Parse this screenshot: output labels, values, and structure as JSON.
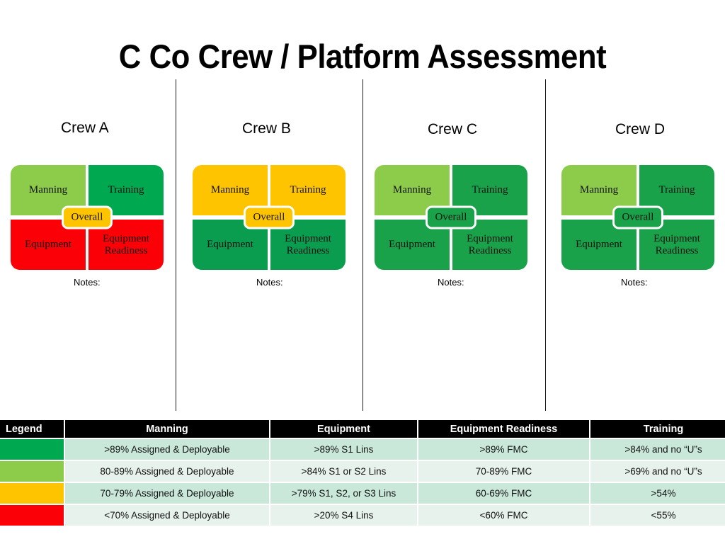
{
  "title": "C Co Crew / Platform Assessment",
  "palette": {
    "green": "#00a84f",
    "light_green": "#8dcc4b",
    "yellow": "#ffc400",
    "red": "#fb0007",
    "header_bg": "#000000",
    "row_shade": "#c9e8da",
    "row_plain": "#e7f2ec"
  },
  "quadrant_labels": {
    "manning": "Manning",
    "training": "Training",
    "equipment": "Equipment",
    "equipment_readiness": "Equipment Readiness",
    "overall": "Overall",
    "notes": "Notes:"
  },
  "crews": [
    {
      "name": "Crew A",
      "manning": "Manning",
      "training": "Training",
      "equipment": "Equipment",
      "equipment_readiness": "Equipment Readiness",
      "overall": "Overall",
      "notes": "Notes:",
      "manning_color": "#8dcc4b",
      "training_color": "#00a84f",
      "equipment_color": "#fb0007",
      "equipment_readiness_color": "#fb0007",
      "overall_color": "#ffc400"
    },
    {
      "name": "Crew B",
      "manning": "Manning",
      "training": "Training",
      "equipment": "Equipment",
      "equipment_readiness": "Equipment Readiness",
      "overall": "Overall",
      "notes": "Notes:",
      "manning_color": "#ffc400",
      "training_color": "#ffc400",
      "equipment_color": "#0a9d4f",
      "equipment_readiness_color": "#0a9d4f",
      "overall_color": "#ffc400"
    },
    {
      "name": "Crew C",
      "manning": "Manning",
      "training": "Training",
      "equipment": "Equipment",
      "equipment_readiness": "Equipment Readiness",
      "overall": "Overall",
      "notes": "Notes:",
      "manning_color": "#8dcc4b",
      "training_color": "#1aa24a",
      "equipment_color": "#1aa24a",
      "equipment_readiness_color": "#1aa24a",
      "overall_color": "#1aa24a"
    },
    {
      "name": "Crew D",
      "manning": "Manning",
      "training": "Training",
      "equipment": "Equipment",
      "equipment_readiness": "Equipment Readiness",
      "overall": "Overall",
      "notes": "Notes:",
      "manning_color": "#8dcc4b",
      "training_color": "#1aa24a",
      "equipment_color": "#1aa24a",
      "equipment_readiness_color": "#1aa24a",
      "overall_color": "#1aa24a"
    }
  ],
  "legend": {
    "headers": [
      "Legend",
      "Manning",
      "Equipment",
      "Equipment Readiness",
      "Training"
    ],
    "rows": [
      {
        "color": "#00a84f",
        "manning": ">89% Assigned & Deployable",
        "equipment": ">89% S1 Lins",
        "equipment_readiness": ">89% FMC",
        "training": ">84% and no “U”s"
      },
      {
        "color": "#8dcc4b",
        "manning": "80-89% Assigned & Deployable",
        "equipment": ">84% S1 or S2 Lins",
        "equipment_readiness": "70-89% FMC",
        "training": ">69% and no “U”s"
      },
      {
        "color": "#ffc400",
        "manning": "70-79% Assigned & Deployable",
        "equipment": ">79% S1, S2, or S3 Lins",
        "equipment_readiness": "60-69% FMC",
        "training": ">54%"
      },
      {
        "color": "#fb0007",
        "manning": "<70% Assigned & Deployable",
        "equipment": ">20% S4 Lins",
        "equipment_readiness": "<60% FMC",
        "training": "<55%"
      }
    ]
  }
}
